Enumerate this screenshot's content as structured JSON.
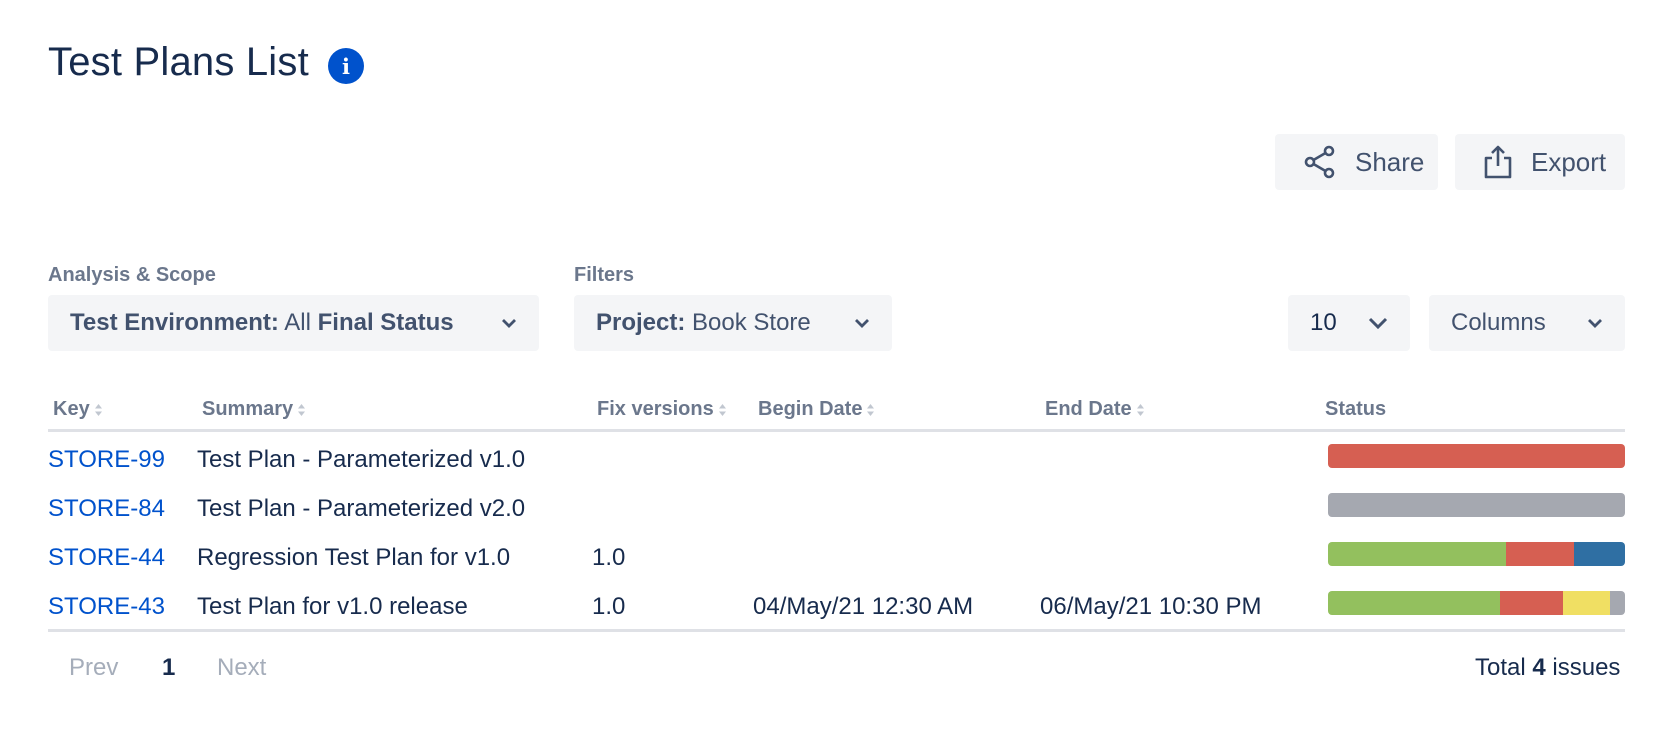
{
  "page": {
    "title": "Test Plans List"
  },
  "toolbar": {
    "share_label": "Share",
    "export_label": "Export"
  },
  "scope": {
    "section_label": "Analysis & Scope",
    "env_key": "Test Environment:",
    "env_value": " All ",
    "final_status": "Final Status"
  },
  "filters": {
    "section_label": "Filters",
    "project_key": "Project:",
    "project_value": " Book Store"
  },
  "page_size": {
    "value": "10"
  },
  "columns": {
    "label": "Columns"
  },
  "table": {
    "headers": {
      "key": "Key",
      "summary": "Summary",
      "fix_versions": "Fix versions",
      "begin_date": "Begin Date",
      "end_date": "End Date",
      "status": "Status"
    },
    "rows": [
      {
        "key": "STORE-99",
        "summary": "Test Plan - Parameterized v1.0",
        "fix": "",
        "begin": "",
        "end": ""
      },
      {
        "key": "STORE-84",
        "summary": "Test Plan - Parameterized v2.0",
        "fix": "",
        "begin": "",
        "end": ""
      },
      {
        "key": "STORE-44",
        "summary": "Regression Test Plan for v1.0",
        "fix": "1.0",
        "begin": "",
        "end": ""
      },
      {
        "key": "STORE-43",
        "summary": "Test Plan for v1.0 release",
        "fix": "1.0",
        "begin": "04/May/21 12:30 AM",
        "end": "06/May/21 10:30 PM"
      }
    ],
    "status_bars": [
      [
        {
          "color": "#d65f52",
          "fraction": 1.0
        }
      ],
      [
        {
          "color": "#a5a8b0",
          "fraction": 1.0
        }
      ],
      [
        {
          "color": "#93c05e",
          "fraction": 0.6
        },
        {
          "color": "#d65f52",
          "fraction": 0.23
        },
        {
          "color": "#2f6fa3",
          "fraction": 0.17
        }
      ],
      [
        {
          "color": "#93c05e",
          "fraction": 0.58
        },
        {
          "color": "#d65f52",
          "fraction": 0.21
        },
        {
          "color": "#f0df63",
          "fraction": 0.16
        },
        {
          "color": "#a5a8b0",
          "fraction": 0.05
        }
      ]
    ]
  },
  "pagination": {
    "prev": "Prev",
    "current": "1",
    "next": "Next"
  },
  "footer": {
    "total_prefix": "Total ",
    "total_count": "4",
    "total_suffix": " issues"
  }
}
